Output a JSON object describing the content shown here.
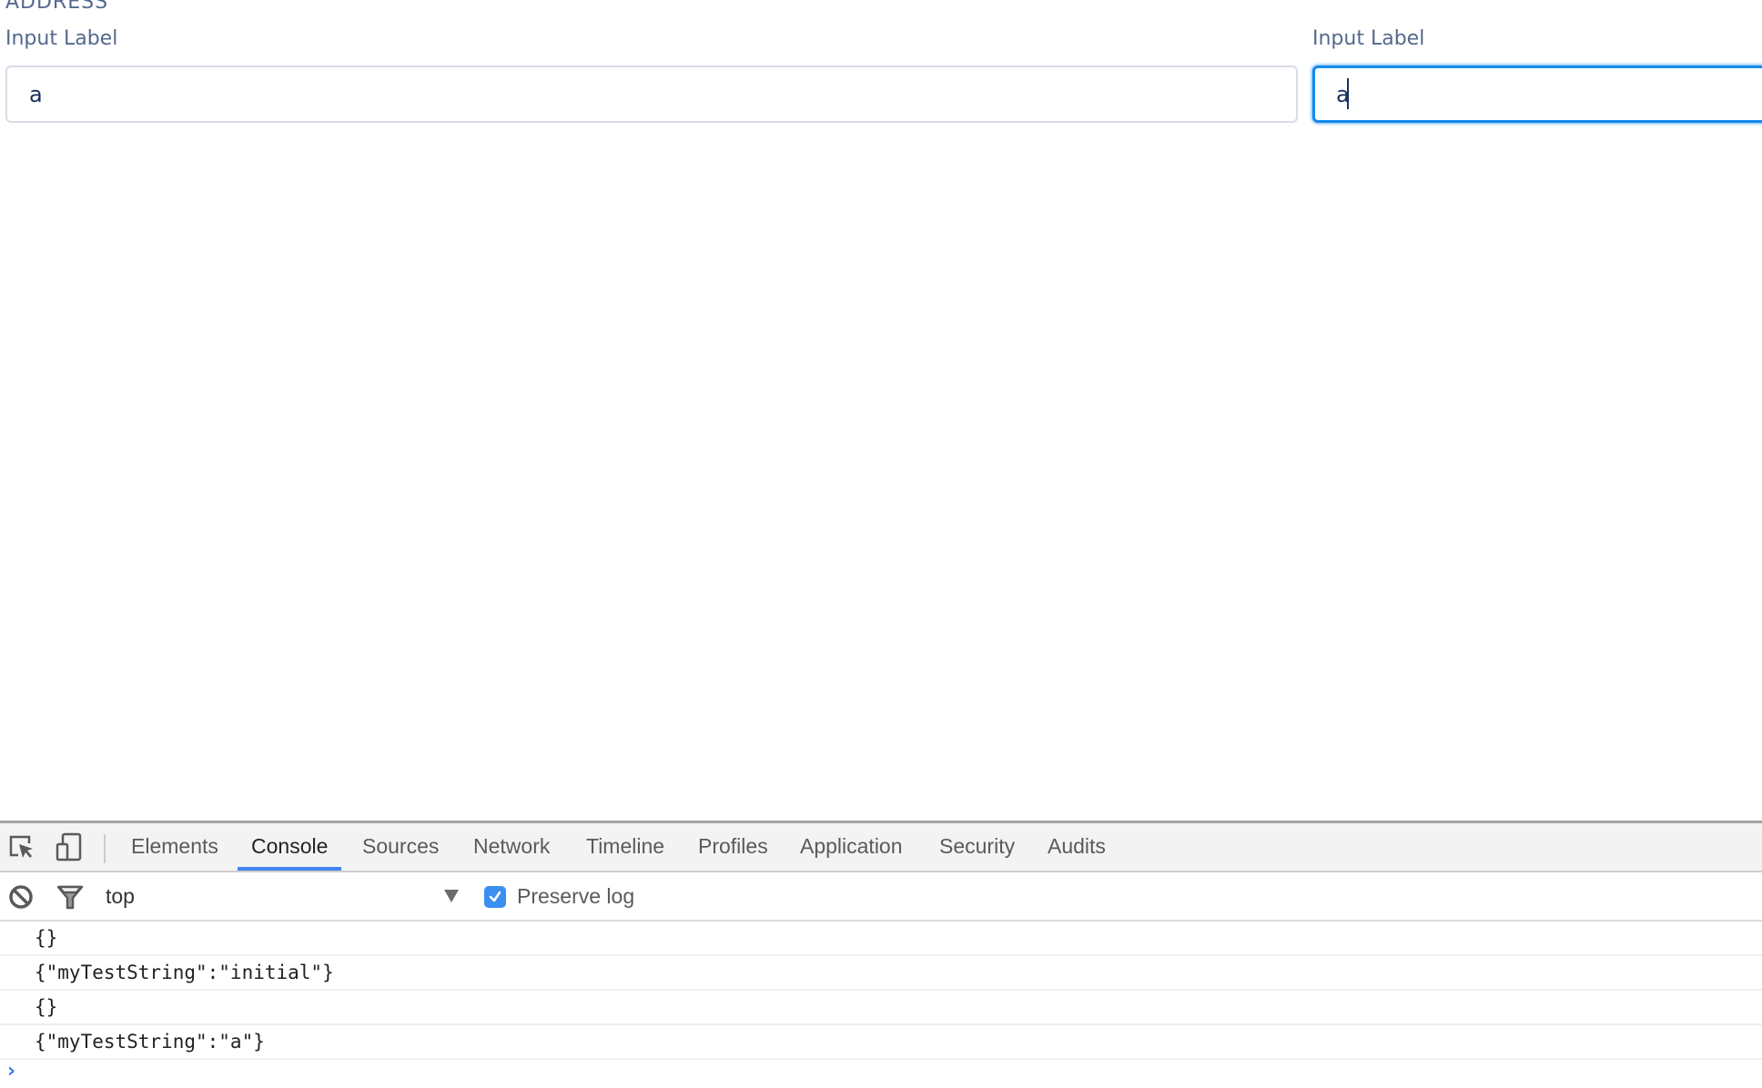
{
  "form": {
    "section_title": "ADDRESS",
    "fields": [
      {
        "label": "Input Label",
        "value": "a",
        "focused": false
      },
      {
        "label": "Input Label",
        "value": "a",
        "focused": true
      }
    ],
    "focus_color": "#1589ee",
    "label_color": "#54698d"
  },
  "devtools": {
    "toolbar_icons": [
      "inspect-element-icon",
      "device-toolbar-icon"
    ],
    "tabs": [
      {
        "label": "Elements",
        "active": false
      },
      {
        "label": "Console",
        "active": true
      },
      {
        "label": "Sources",
        "active": false
      },
      {
        "label": "Network",
        "active": false
      },
      {
        "label": "Timeline",
        "active": false
      },
      {
        "label": "Profiles",
        "active": false
      },
      {
        "label": "Application",
        "active": false
      },
      {
        "label": "Security",
        "active": false
      },
      {
        "label": "Audits",
        "active": false
      }
    ],
    "filter_bar": {
      "clear_icon": "clear-console-icon",
      "filter_icon": "filter-icon",
      "context": "top",
      "preserve_log_label": "Preserve log",
      "preserve_log_checked": true
    },
    "console_messages": [
      "{}",
      "{\"myTestString\":\"initial\"}",
      "{}",
      "{\"myTestString\":\"a\"}"
    ],
    "prompt_symbol": "›",
    "accent_color": "#4284f3"
  }
}
